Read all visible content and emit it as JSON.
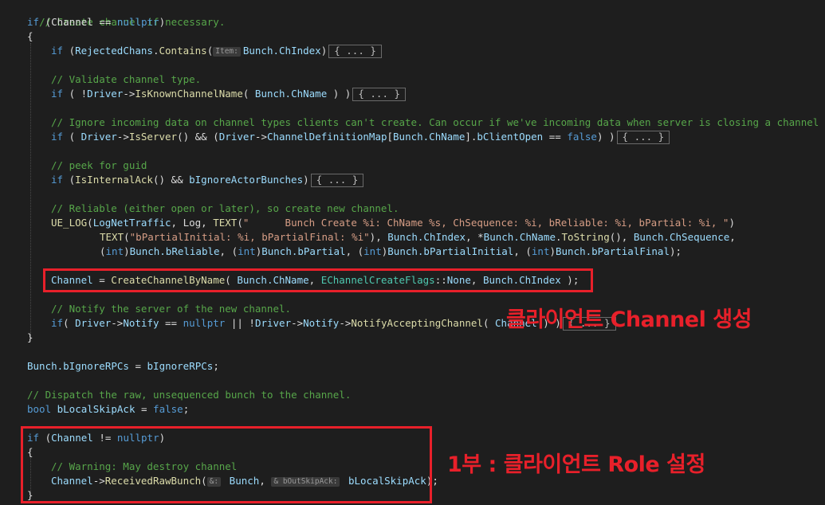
{
  "code": {
    "l1_comment": "// Create channel if necessary.",
    "l2_if": "if",
    "l2_rest_a": " (Channel == ",
    "l2_null": "nullptr",
    "l2_rest_b": ")",
    "l3_brace": "{",
    "l4_if": "if",
    "l4_open": " (",
    "l4_obj": "RejectedChans",
    "l4_dot": ".",
    "l4_fn": "Contains",
    "l4_paren": "(",
    "l4_hint": "Item:",
    "l4_arg": "Bunch.ChIndex",
    "l4_close": ")",
    "fold": "{ ... }",
    "l5_comment": "// Validate channel type.",
    "l6_if": "if",
    "l6_a": " ( !",
    "l6_obj": "Driver",
    "l6_arrow": "->",
    "l6_fn": "IsKnownChannelName",
    "l6_b": "( ",
    "l6_arg": "Bunch.ChName",
    "l6_c": " ) )",
    "l7_comment": "// Ignore incoming data on channel types clients can't create. Can occur if we've incoming data when server is closing a channel",
    "l8_if": "if",
    "l8_a": " ( ",
    "l8_obj": "Driver",
    "l8_arrow": "->",
    "l8_fn": "IsServer",
    "l8_b": "() && (",
    "l8_obj2": "Driver",
    "l8_arrow2": "->",
    "l8_map": "ChannelDefinitionMap",
    "l8_c": "[",
    "l8_arg": "Bunch.ChName",
    "l8_d": "].",
    "l8_mem": "bClientOpen",
    "l8_e": " == ",
    "l8_false": "false",
    "l8_f": ") )",
    "l9_comment": "// peek for guid",
    "l10_if": "if",
    "l10_a": " (",
    "l10_fn": "IsInternalAck",
    "l10_b": "() && ",
    "l10_mem": "bIgnoreActorBunches",
    "l10_c": ")",
    "l11_comment": "// Reliable (either open or later), so create new channel.",
    "l12_fn": "UE_LOG",
    "l12_a": "(",
    "l12_cat": "LogNetTraffic",
    "l12_b": ", Log, ",
    "l12_text": "TEXT",
    "l12_c": "(",
    "l12_str": "\"      Bunch Create %i: ChName %s, ChSequence: %i, bReliable: %i, bPartial: %i, \"",
    "l12_d": ")",
    "l13_text": "TEXT",
    "l13_a": "(",
    "l13_str": "\"bPartialInitial: %i, bPartialFinal: %i\"",
    "l13_b": "), ",
    "l13_arg1": "Bunch.ChIndex",
    "l13_c": ", *",
    "l13_arg2": "Bunch.ChName",
    "l13_dot": ".",
    "l13_fn": "ToString",
    "l13_d": "(), ",
    "l13_arg3": "Bunch.ChSequence",
    "l13_e": ",",
    "l14_a": "(",
    "l14_int1": "int",
    "l14_b": ")",
    "l14_arg1": "Bunch.bReliable",
    "l14_c": ", (",
    "l14_int2": "int",
    "l14_d": ")",
    "l14_arg2": "Bunch.bPartial",
    "l14_e": ", (",
    "l14_int3": "int",
    "l14_f": ")",
    "l14_arg3": "Bunch.bPartialInitial",
    "l14_g": ", (",
    "l14_int4": "int",
    "l14_h": ")",
    "l14_arg4": "Bunch.bPartialFinal",
    "l14_i": ");",
    "l15_var": "Channel",
    "l15_a": " = ",
    "l15_fn": "CreateChannelByName",
    "l15_b": "( ",
    "l15_arg1": "Bunch.ChName",
    "l15_c": ", ",
    "l15_type": "EChannelCreateFlags",
    "l15_d": "::",
    "l15_none": "None",
    "l15_e": ", ",
    "l15_arg2": "Bunch.ChIndex",
    "l15_f": " );",
    "l16_comment": "// Notify the server of the new channel.",
    "l17_if": "if",
    "l17_a": "( ",
    "l17_obj": "Driver",
    "l17_arrow": "->",
    "l17_mem": "Notify",
    "l17_b": " == ",
    "l17_null": "nullptr",
    "l17_c": " || !",
    "l17_obj2": "Driver",
    "l17_arrow2": "->",
    "l17_mem2": "Notify",
    "l17_arrow3": "->",
    "l17_fn": "NotifyAcceptingChannel",
    "l17_d": "( ",
    "l17_arg": "Channel",
    "l17_e": " ) )",
    "l18_brace": "}",
    "l19_a": "Bunch.bIgnoreRPCs",
    "l19_b": " = ",
    "l19_c": "bIgnoreRPCs",
    "l19_d": ";",
    "l20_comment": "// Dispatch the raw, unsequenced bunch to the channel.",
    "l21_bool": "bool",
    "l21_var": " bLocalSkipAck",
    "l21_a": " = ",
    "l21_false": "false",
    "l21_b": ";",
    "l22_if": "if",
    "l22_a": " (",
    "l22_var": "Channel",
    "l22_b": " != ",
    "l22_null": "nullptr",
    "l22_c": ")",
    "l23_brace": "{",
    "l24_comment": "// Warning: May destroy channel",
    "l25_var": "Channel",
    "l25_arrow": "->",
    "l25_fn": "ReceivedRawBunch",
    "l25_a": "(",
    "l25_hint1": "&:",
    "l25_arg1": " Bunch",
    "l25_b": ", ",
    "l25_hint2": "& bOutSkipAck:",
    "l25_arg2": " bLocalSkipAck",
    "l25_c": ");",
    "l26_brace": "}"
  },
  "annotations": {
    "create_label": "클라이언트 Channel 생성",
    "role_label": "1부 : 클라이언트 Role 설정"
  },
  "colors": {
    "background": "#1e1e1e",
    "comment": "#57a64a",
    "keyword": "#569cd6",
    "identifier": "#9cdcfe",
    "function": "#dcdcaa",
    "type": "#4ec9b0",
    "string": "#d69d85",
    "highlight_red": "#e8202a"
  }
}
